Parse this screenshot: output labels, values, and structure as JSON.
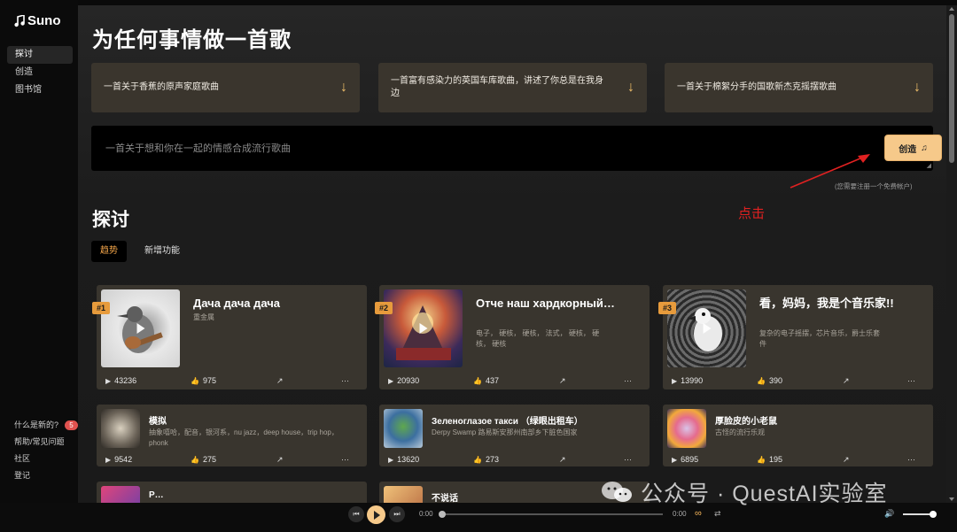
{
  "brand": {
    "name": "Suno"
  },
  "sidebar": {
    "items": [
      {
        "label": "探讨",
        "active": true
      },
      {
        "label": "创造",
        "active": false
      },
      {
        "label": "图书馆",
        "active": false
      }
    ],
    "bottom": [
      {
        "label": "什么是新的?",
        "badge": "5"
      },
      {
        "label": "帮助/常见问题"
      },
      {
        "label": "社区"
      },
      {
        "label": "登记"
      }
    ]
  },
  "main": {
    "title": "为任何事情做一首歌",
    "suggestions": [
      {
        "text": "一首关于香蕉的原声家庭歌曲",
        "icon": "arrow-down-icon"
      },
      {
        "text": "一首富有感染力的英国车库歌曲，讲述了你总是在我身边",
        "icon": "arrow-down-icon"
      },
      {
        "text": "一首关于棉絮分手的国歌新杰克摇摆歌曲",
        "icon": "arrow-down-icon"
      }
    ],
    "prompt": {
      "placeholder": "一首关于想和你在一起的情感合成流行歌曲",
      "create_label": "创造"
    },
    "register_note": "(您需要注册一个免费帐户)",
    "annotation": "点击",
    "section_title": "探讨",
    "tabs": [
      {
        "label": "趋势",
        "active": true
      },
      {
        "label": "新增功能",
        "active": false
      }
    ],
    "top_cards": [
      {
        "rank": "#1",
        "title": "Дача дача дача",
        "subtitle": "重金属",
        "plays": "43236",
        "likes": "975"
      },
      {
        "rank": "#2",
        "title": "Отче наш хардкорный…",
        "subtitle": "电子， 硬核， 硬核， 法式， 硬核， 硬核， 硬核",
        "plays": "20930",
        "likes": "437"
      },
      {
        "rank": "#3",
        "title": "看，妈妈，我是个音乐家!!",
        "subtitle": "复杂的电子摇摆，芯片音乐，爵士乐套件",
        "plays": "13990",
        "likes": "390"
      }
    ],
    "small_cards": [
      {
        "title": "模拟",
        "subtitle": "抽象嘻哈，配音，银河系，nu jazz，deep house，trip hop，phonk",
        "plays": "9542",
        "likes": "275"
      },
      {
        "title": "Зеленоглазое такси （绿眼出租车）",
        "subtitle": "Derpy Swamp 路易斯安那州南部乡下脏色国家",
        "plays": "13620",
        "likes": "273"
      },
      {
        "title": "厚脸皮的小老鼠",
        "subtitle": "古怪的流行乐观",
        "plays": "6895",
        "likes": "195"
      }
    ],
    "partial_cards": [
      {
        "title": "Р…"
      },
      {
        "title": "不说话"
      }
    ]
  },
  "player": {
    "current": "0:00",
    "duration": "0:00",
    "progress": 0,
    "volume": 1.0
  },
  "watermark": "公众号 · QuestAI实验室",
  "colors": {
    "accent": "#f6c98a",
    "rank": "#e79b3c",
    "annotation": "#e02121"
  }
}
